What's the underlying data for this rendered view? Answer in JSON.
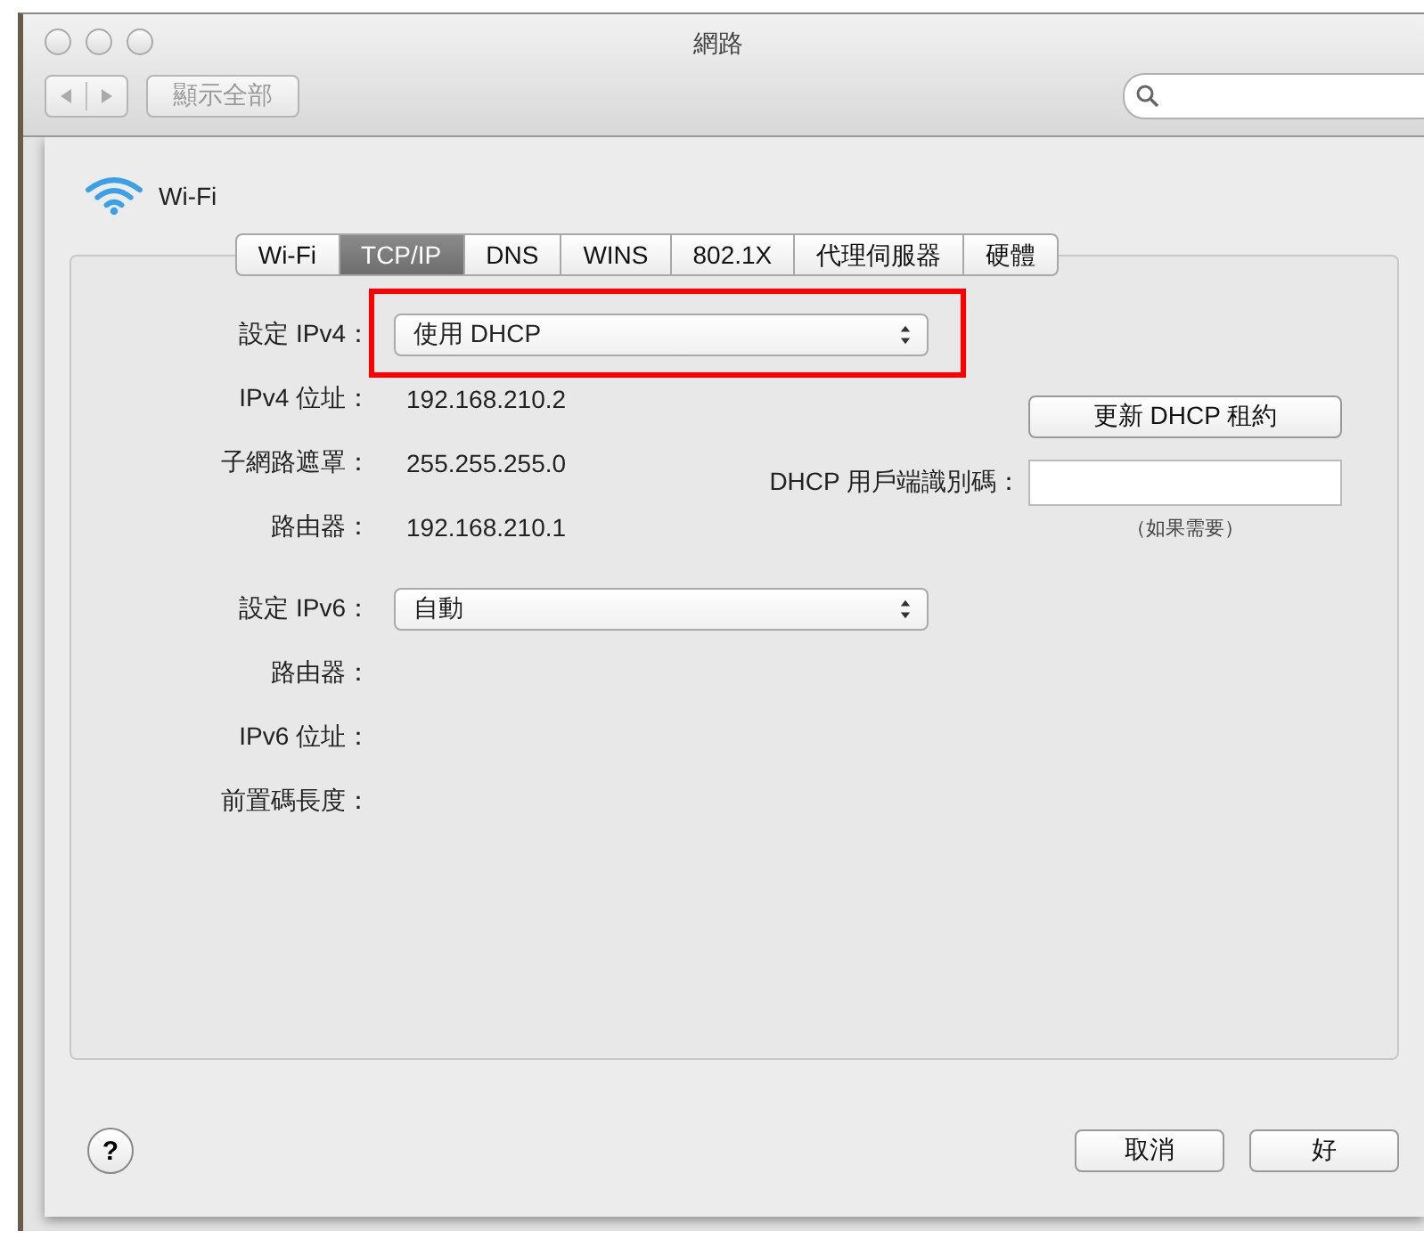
{
  "window": {
    "title": "網路"
  },
  "toolbar": {
    "show_all": "顯示全部"
  },
  "network": {
    "name": "Wi-Fi"
  },
  "tabs": [
    {
      "label": "Wi-Fi",
      "selected": false
    },
    {
      "label": "TCP/IP",
      "selected": true
    },
    {
      "label": "DNS",
      "selected": false
    },
    {
      "label": "WINS",
      "selected": false
    },
    {
      "label": "802.1X",
      "selected": false
    },
    {
      "label": "代理伺服器",
      "selected": false
    },
    {
      "label": "硬體",
      "selected": false
    }
  ],
  "ipv4_rows": [
    {
      "kind": "select",
      "label": "設定 IPv4：",
      "value": "使用 DHCP",
      "highlighted": true
    },
    {
      "kind": "text",
      "label": "IPv4 位址：",
      "value": "192.168.210.2"
    },
    {
      "kind": "text",
      "label": "子網路遮罩：",
      "value": "255.255.255.0"
    },
    {
      "kind": "text",
      "label": "路由器：",
      "value": "192.168.210.1"
    }
  ],
  "ipv6_rows": [
    {
      "kind": "select",
      "label": "設定 IPv6：",
      "value": "自動",
      "highlighted": false
    },
    {
      "kind": "text",
      "label": "路由器："
    },
    {
      "kind": "text",
      "label": "IPv6 位址："
    },
    {
      "kind": "text",
      "label": "前置碼長度："
    }
  ],
  "renew_button": "更新 DHCP 租約",
  "client_id": {
    "label": "DHCP 用戶端識別碼：",
    "hint": "（如果需要）"
  },
  "help": "?",
  "buttons": [
    "取消",
    "好"
  ]
}
